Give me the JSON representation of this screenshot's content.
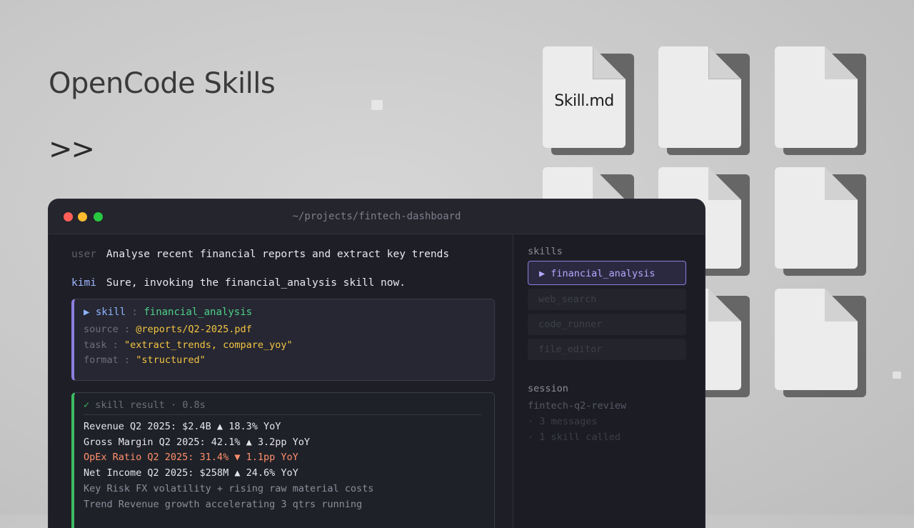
{
  "hero": {
    "title": "OpenCode Skills",
    "prompt_glyph": ">>"
  },
  "files": {
    "featured_label": "Skill.md"
  },
  "terminal": {
    "path": "~/projects/fintech-dashboard",
    "user_message": {
      "role": "user",
      "text": "Analyse recent financial reports and extract key trends"
    },
    "assistant_message": {
      "role": "kimi",
      "text": "Sure, invoking the financial_analysis skill now."
    },
    "skill_call": {
      "arrow": "▶",
      "keyword": "skill",
      "separator": ":",
      "name": "financial_analysis",
      "params": [
        {
          "key": "source",
          "sep": ":",
          "value": "@reports/Q2-2025.pdf"
        },
        {
          "key": "task",
          "sep": ":",
          "value": "\"extract_trends, compare_yoy\""
        },
        {
          "key": "format",
          "sep": ":",
          "value": "\"structured\""
        }
      ]
    },
    "skill_result": {
      "check": "✓",
      "header": "skill result · 0.8s",
      "lines": [
        "Revenue Q2 2025: $2.4B ▲ 18.3% YoY",
        "Gross Margin Q2 2025: 42.1% ▲ 3.2pp YoY",
        "OpEx Ratio Q2 2025: 31.4% ▼ 1.1pp YoY",
        "Net Income Q2 2025: $258M ▲ 24.6% YoY",
        "Key Risk FX volatility + rising raw material costs",
        "Trend Revenue growth accelerating 3 qtrs running"
      ]
    },
    "sidebar": {
      "skills_label": "skills",
      "skills": [
        {
          "label": "▶ financial_analysis",
          "active": true
        },
        {
          "label": "web_search",
          "active": false
        },
        {
          "label": "code_runner",
          "active": false
        },
        {
          "label": "file_editor",
          "active": false
        }
      ],
      "session_label": "session",
      "session_name": "fintech-q2-review",
      "session_stats": [
        "· 3 messages",
        "· 1 skill called"
      ]
    }
  },
  "colors": {
    "accent_purple": "#8b7fe0",
    "success_green": "#3dbb62",
    "value_yellow": "#f4c542",
    "warning_orange": "#ff8f6b"
  }
}
